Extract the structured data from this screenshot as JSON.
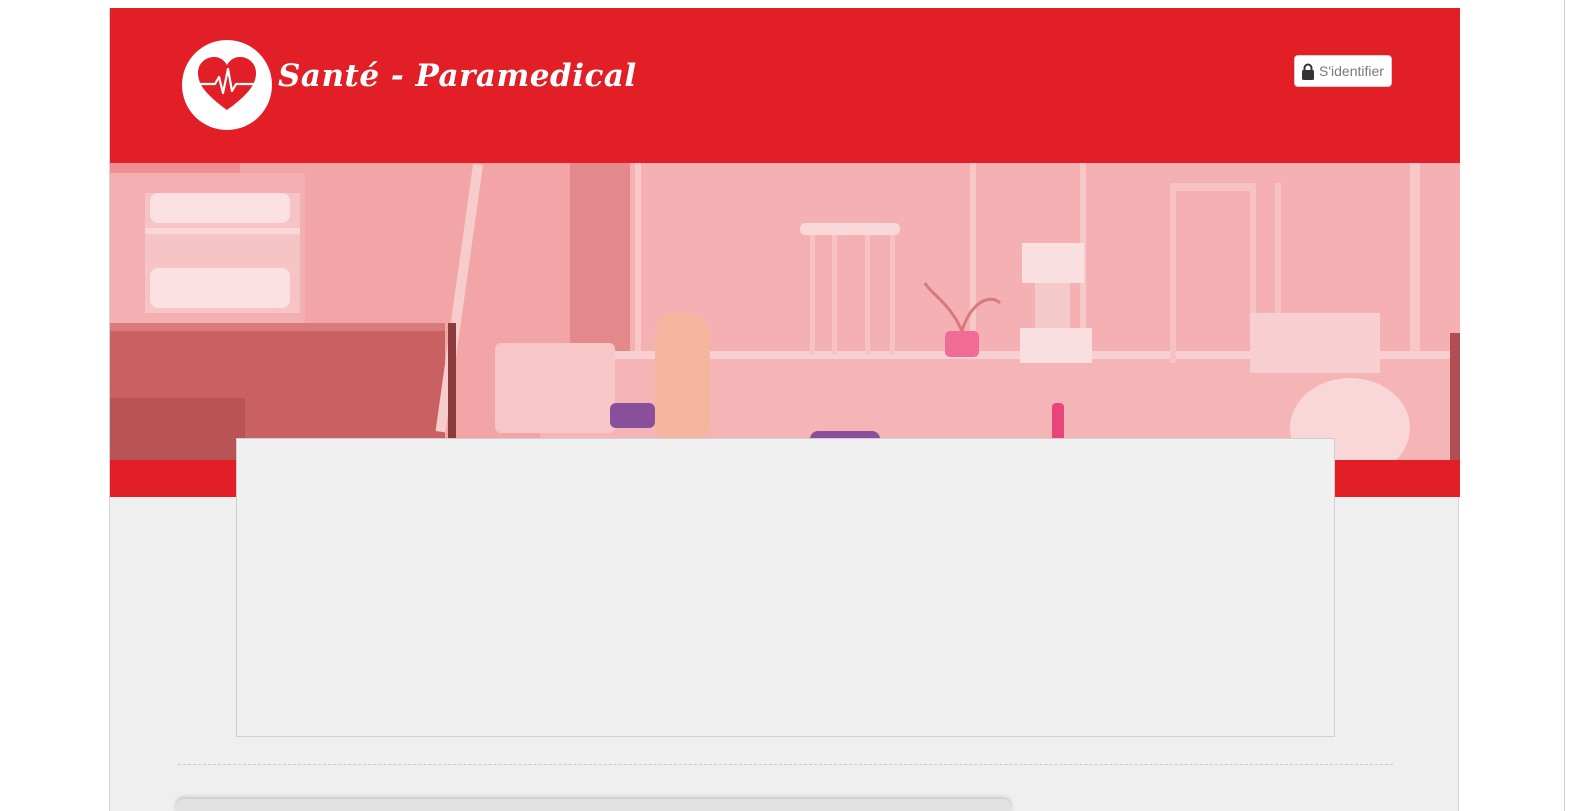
{
  "header": {
    "site_title": "Santé - Paramedical",
    "logo_icon": "heart-pulse-icon",
    "login_label": "S'identifier",
    "login_icon": "lock-icon"
  },
  "colors": {
    "brand_red": "#e21e26",
    "page_background": "#efefef",
    "banner_tint": "#ee8e91"
  }
}
